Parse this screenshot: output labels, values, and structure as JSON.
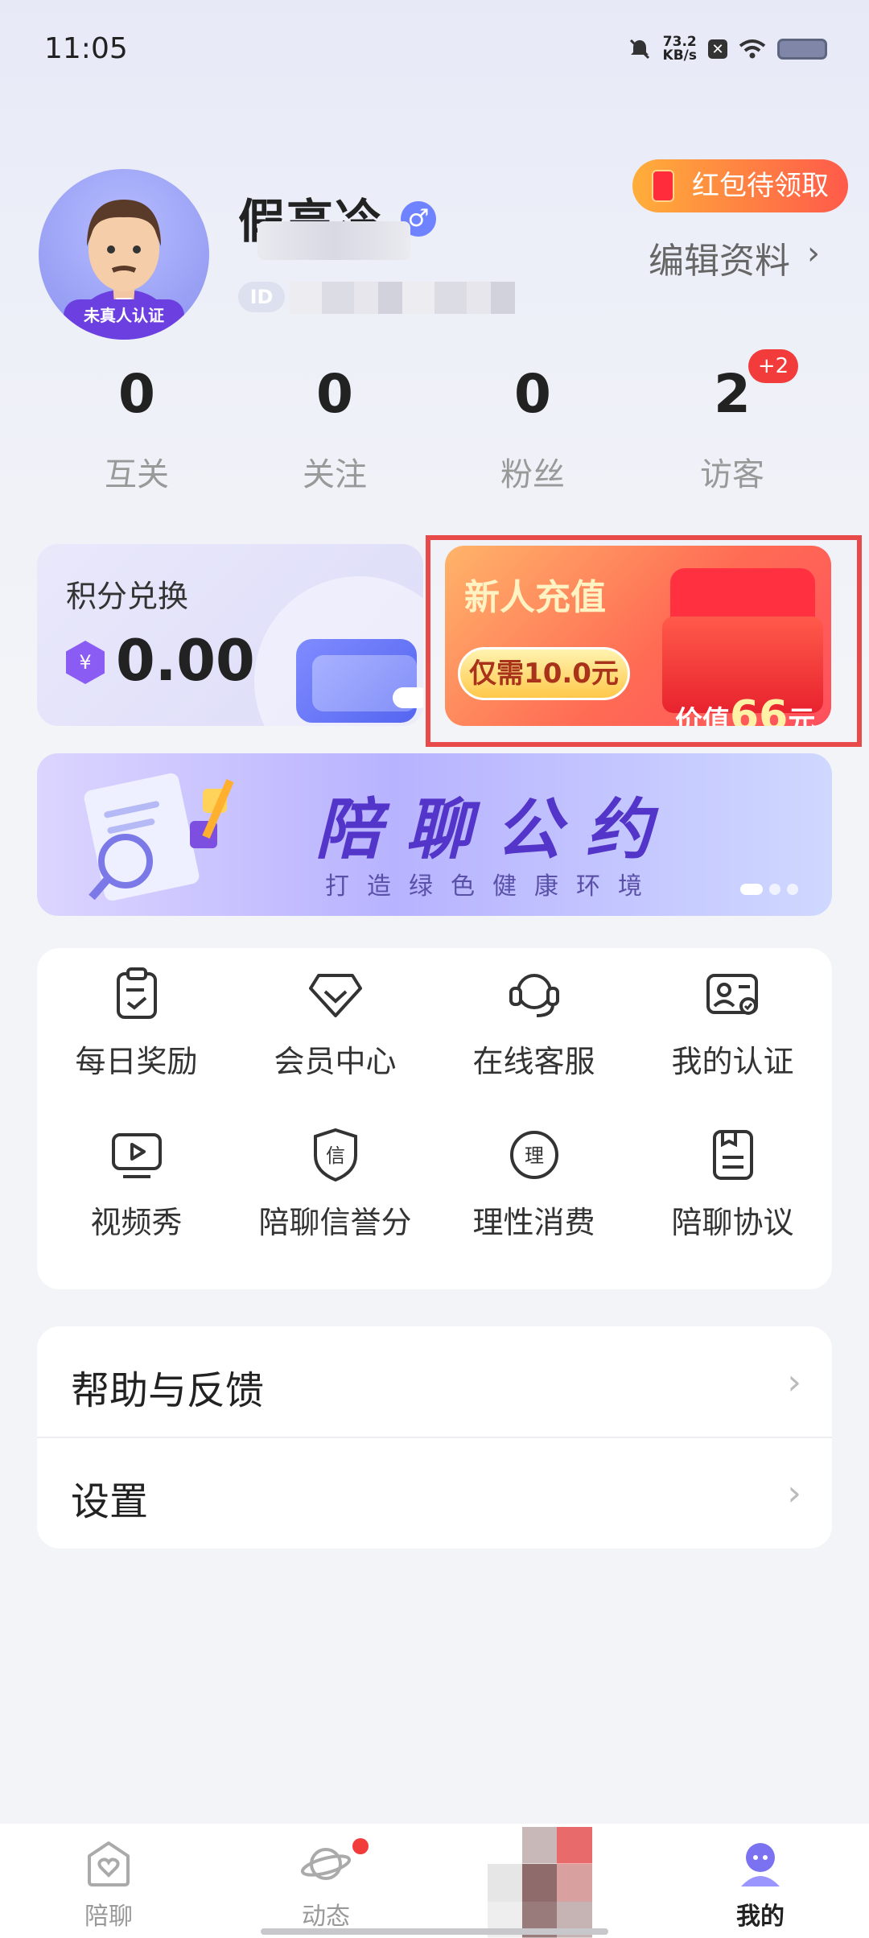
{
  "status_bar": {
    "time": "11:05",
    "net_speed": "73.2",
    "net_unit": "KB/s",
    "sq_glyph": "✕"
  },
  "profile": {
    "name": "假高冷",
    "gender_symbol": "♂",
    "avatar_badge": "未真人认证",
    "id_label": "ID",
    "red_packet": "红包待领取",
    "edit": "编辑资料",
    "edit_chevron": "›"
  },
  "stats": [
    {
      "value": "0",
      "label": "互关"
    },
    {
      "value": "0",
      "label": "关注"
    },
    {
      "value": "0",
      "label": "粉丝"
    },
    {
      "value": "2",
      "label": "访客"
    }
  ],
  "visitor_badge": "+2",
  "points": {
    "title": "积分兑换",
    "value": "0.00",
    "coin_symbol": "¥"
  },
  "recharge": {
    "title": "新人充值",
    "price": "仅需10.0元",
    "value_prefix": "价值",
    "value_num": "66",
    "value_suffix": "元"
  },
  "banner": {
    "title": "陪聊公约",
    "subtitle": "打造绿色健康环境"
  },
  "grid": [
    {
      "label": "每日奖励",
      "icon": "clipboard-check-icon"
    },
    {
      "label": "会员中心",
      "icon": "diamond-icon"
    },
    {
      "label": "在线客服",
      "icon": "headset-icon"
    },
    {
      "label": "我的认证",
      "icon": "id-card-icon"
    },
    {
      "label": "视频秀",
      "icon": "video-play-icon"
    },
    {
      "label": "陪聊信誉分",
      "icon": "shield-trust-icon",
      "glyph": "信"
    },
    {
      "label": "理性消费",
      "icon": "rational-circle-icon",
      "glyph": "理"
    },
    {
      "label": "陪聊协议",
      "icon": "document-icon"
    }
  ],
  "list": [
    {
      "label": "帮助与反馈",
      "chevron": "›"
    },
    {
      "label": "设置",
      "chevron": "›"
    }
  ],
  "nav": [
    {
      "label": "陪聊",
      "icon": "heart-home-icon"
    },
    {
      "label": "动态",
      "icon": "planet-icon"
    },
    {
      "label": "我的",
      "icon": "profile-icon",
      "active": true
    }
  ],
  "colors": {
    "accent": "#6b3fe0",
    "badge_red": "#f23b3b",
    "recharge_orange": "#ff6b54"
  }
}
